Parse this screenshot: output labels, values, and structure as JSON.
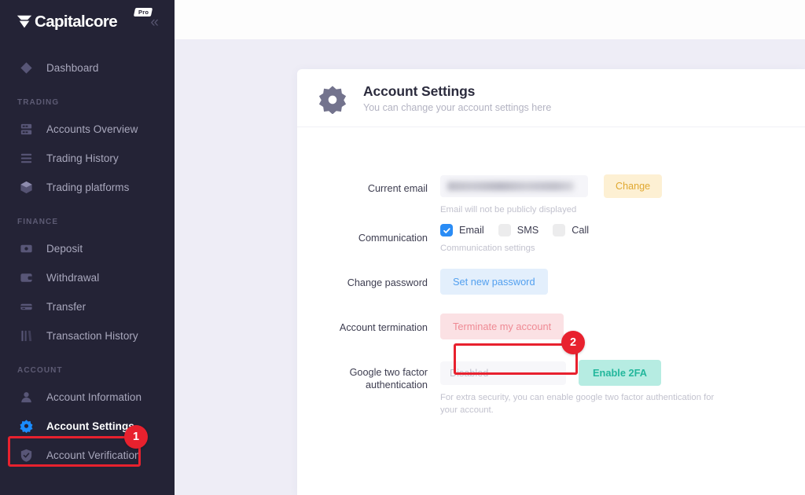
{
  "brand": {
    "name": "Capitalcore",
    "badge": "Pro",
    "logo_icon": "chevron-shield-logo",
    "collapse_icon": "double-chevron-left-icon"
  },
  "sidebar": {
    "groups": [
      {
        "label": "",
        "items": [
          {
            "label": "Dashboard",
            "icon": "diamond-icon",
            "active": false
          }
        ]
      },
      {
        "label": "TRADING",
        "items": [
          {
            "label": "Accounts Overview",
            "icon": "server-stack-icon",
            "active": false
          },
          {
            "label": "Trading History",
            "icon": "list-lines-icon",
            "active": false
          },
          {
            "label": "Trading platforms",
            "icon": "cube-icon",
            "active": false
          }
        ]
      },
      {
        "label": "FINANCE",
        "items": [
          {
            "label": "Deposit",
            "icon": "banknote-icon",
            "active": false
          },
          {
            "label": "Withdrawal",
            "icon": "wallet-icon",
            "active": false
          },
          {
            "label": "Transfer",
            "icon": "transfer-card-icon",
            "active": false
          },
          {
            "label": "Transaction History",
            "icon": "bar-columns-icon",
            "active": false
          }
        ]
      },
      {
        "label": "ACCOUNT",
        "items": [
          {
            "label": "Account Information",
            "icon": "user-icon",
            "active": false
          },
          {
            "label": "Account Settings",
            "icon": "gear-icon",
            "active": true
          },
          {
            "label": "Account Verification",
            "icon": "shield-check-icon",
            "active": false
          }
        ]
      }
    ]
  },
  "card": {
    "icon": "gear-icon",
    "title": "Account Settings",
    "subtitle": "You can change your account settings here"
  },
  "form": {
    "email": {
      "label": "Current email",
      "value": "",
      "redacted": true,
      "change_button": "Change",
      "help": "Email will not be publicly displayed"
    },
    "communication": {
      "label": "Communication",
      "options": [
        {
          "label": "Email",
          "checked": true
        },
        {
          "label": "SMS",
          "checked": false
        },
        {
          "label": "Call",
          "checked": false
        }
      ],
      "help": "Communication settings"
    },
    "password": {
      "label": "Change password",
      "button": "Set new password"
    },
    "termination": {
      "label": "Account termination",
      "button": "Terminate my account"
    },
    "twofa": {
      "label": "Google two factor authentication",
      "status": "Disabled",
      "button": "Enable 2FA",
      "help": "For extra security, you can enable google two factor authentication for your account."
    }
  },
  "annotations": [
    {
      "number": "1",
      "target": "Account Settings"
    },
    {
      "number": "2",
      "target": "Terminate my account"
    }
  ],
  "colors": {
    "sidebar_bg": "#242336",
    "page_bg": "#eeedf6",
    "accent_blue": "#2a8cf5",
    "annotation_red": "#e8212e",
    "warning_yellow": "#e0a830",
    "danger_pink": "#ef8a94",
    "teal": "#23b79c"
  }
}
